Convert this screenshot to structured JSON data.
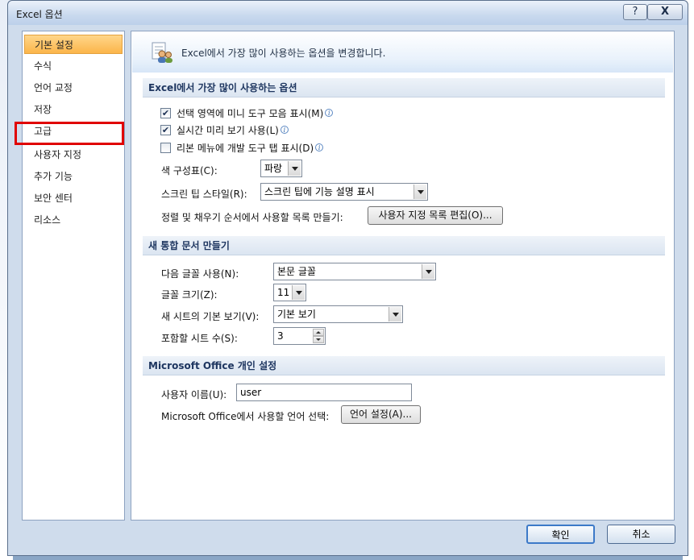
{
  "window": {
    "title": "Excel 옵션",
    "help_label": "?",
    "close_label": "X"
  },
  "nav": {
    "items": [
      {
        "label": "기본 설정",
        "selected": true
      },
      {
        "label": "수식"
      },
      {
        "label": "언어 교정"
      },
      {
        "label": "저장"
      },
      {
        "label": "고급"
      },
      {
        "label": "사용자 지정"
      },
      {
        "label": "추가 기능"
      },
      {
        "label": "보안 센터"
      },
      {
        "label": "리소스"
      }
    ]
  },
  "header": {
    "text": "Excel에서 가장 많이 사용하는 옵션을 변경합니다.",
    "icon": "people-settings-icon"
  },
  "section1": {
    "title": "Excel에서 가장 많이 사용하는 옵션",
    "checkboxes": [
      {
        "label": "선택 영역에 미니 도구 모음 표시(M)",
        "checked": true
      },
      {
        "label": "실시간 미리 보기 사용(L)",
        "checked": true
      },
      {
        "label": "리본 메뉴에 개발 도구 탭 표시(D)",
        "checked": false
      }
    ],
    "info_glyph": "i",
    "color_scheme_label": "색 구성표(C):",
    "color_scheme_value": "파랑",
    "screentip_label": "스크린 팁 스타일(R):",
    "screentip_value": "스크린 팁에 기능 설명 표시",
    "sort_lists_label": "정렬 및 채우기 순서에서 사용할 목록 만들기:",
    "sort_lists_button": "사용자 지정 목록 편집(O)..."
  },
  "section2": {
    "title": "새 통합 문서 만들기",
    "font_label": "다음 글꼴 사용(N):",
    "font_value": "본문 글꼴",
    "size_label": "글꼴 크기(Z):",
    "size_value": "11",
    "view_label": "새 시트의 기본 보기(V):",
    "view_value": "기본 보기",
    "sheets_label": "포함할 시트 수(S):",
    "sheets_value": "3"
  },
  "section3": {
    "title": "Microsoft Office 개인 설정",
    "username_label": "사용자 이름(U):",
    "username_value": "user",
    "language_label": "Microsoft Office에서 사용할 언어 선택:",
    "language_button": "언어 설정(A)..."
  },
  "footer": {
    "ok_label": "확인",
    "cancel_label": "취소"
  },
  "colors": {
    "accent_selected": "#fbb54a",
    "highlight_box": "#e00000",
    "section_text": "#1e3660"
  }
}
